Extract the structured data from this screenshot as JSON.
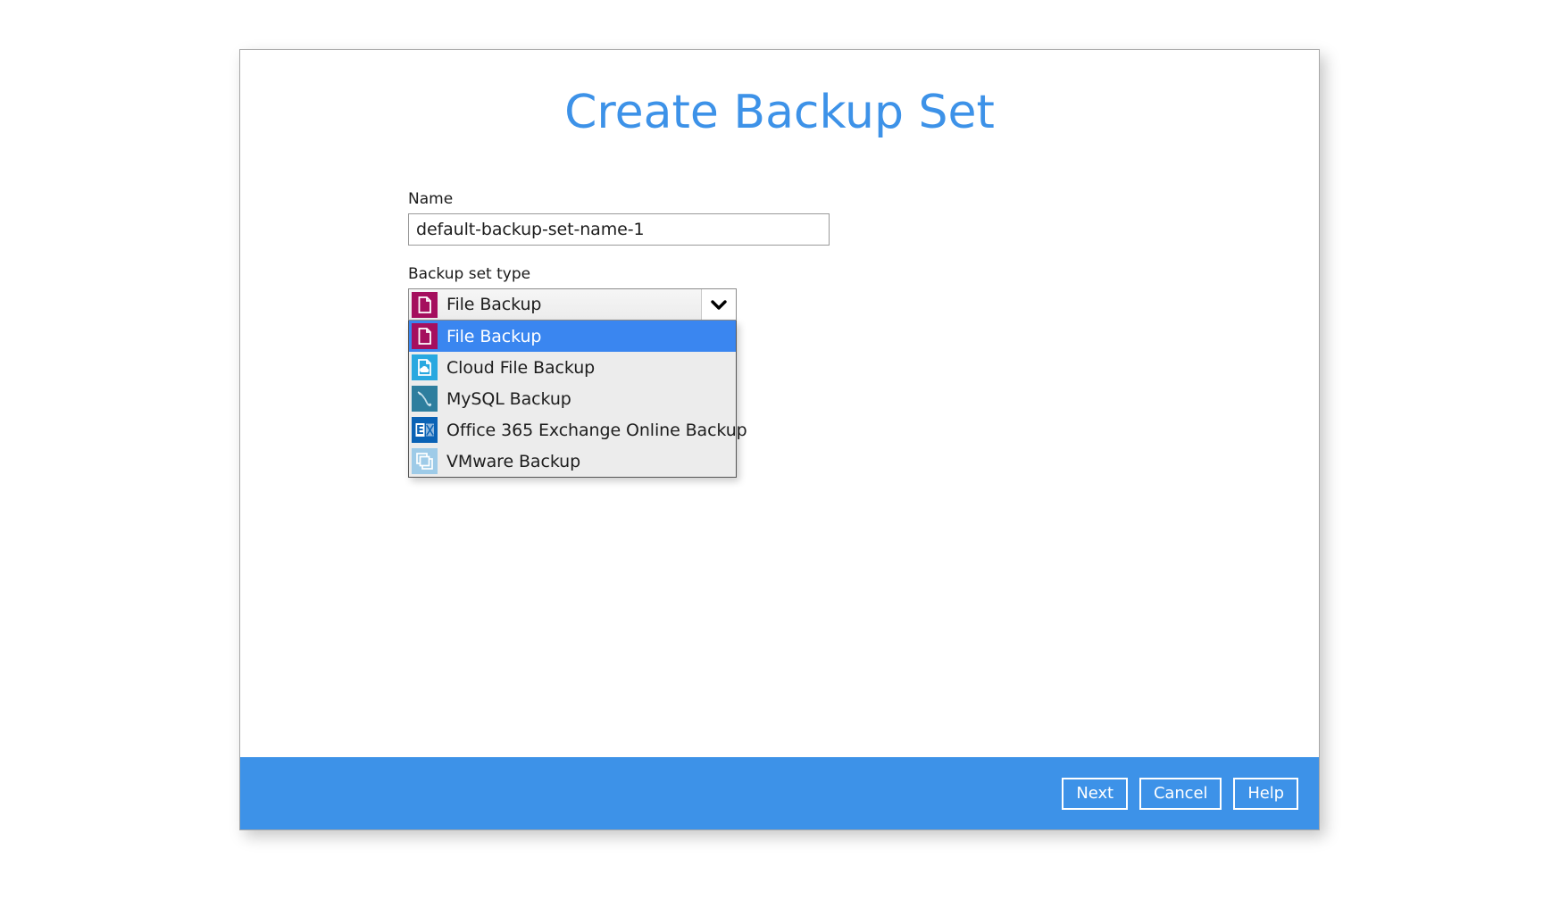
{
  "dialog": {
    "title": "Create Backup Set",
    "accent_color": "#3d92e8"
  },
  "form": {
    "name_label": "Name",
    "name_value": "default-backup-set-name-1",
    "name_placeholder": "",
    "type_label": "Backup set type",
    "type_selected": "File Backup",
    "type_selected_icon": "file-backup-icon",
    "dropdown_arrow_icon": "chevron-down-icon",
    "options": [
      {
        "label": "File Backup",
        "icon": "file-backup-icon",
        "icon_color": "#a50f5e",
        "selected": true
      },
      {
        "label": "Cloud File Backup",
        "icon": "cloud-file-backup-icon",
        "icon_color": "#28a8e0",
        "selected": false
      },
      {
        "label": "MySQL Backup",
        "icon": "mysql-backup-icon",
        "icon_color": "#2e7e9e",
        "selected": false
      },
      {
        "label": "Office 365 Exchange Online Backup",
        "icon": "office365-exchange-online-backup-icon",
        "icon_color": "#0a62b5",
        "selected": false
      },
      {
        "label": "VMware Backup",
        "icon": "vmware-backup-icon",
        "icon_color": "#9ecbe8",
        "selected": false
      }
    ]
  },
  "footer": {
    "next_label": "Next",
    "cancel_label": "Cancel",
    "help_label": "Help"
  }
}
